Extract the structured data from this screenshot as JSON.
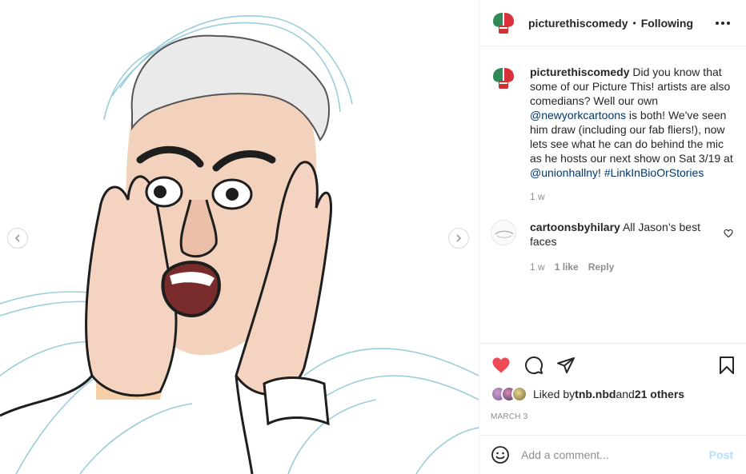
{
  "post": {
    "author": "picturethiscomedy",
    "separator": "•",
    "follow_state": "Following",
    "more_icon": "more-horizontal-icon"
  },
  "caption": {
    "username": "picturethiscomedy",
    "text_1": " Did you know that some of our Picture This! artists are also comedians? Well our own ",
    "mention_1": "@newyorkcartoons",
    "text_2": " is both! We've seen him draw (including our fab fliers!), now lets see what he can do behind the mic as he hosts our next show on Sat 3/19 at ",
    "mention_2": "@unionhallny",
    "text_3": "! ",
    "hashtag": "#LinkInBioOrStories",
    "age": "1 w"
  },
  "comments": [
    {
      "username": "cartoonsbyhilary",
      "text": " All Jason’s best faces",
      "age": "1 w",
      "likes": "1 like",
      "reply": "Reply"
    }
  ],
  "actions": {
    "liked": true,
    "like_color": "#ed4956"
  },
  "likes": {
    "prefix": "Liked by ",
    "user": "tnb.nbd",
    "middle": " and ",
    "others": "21 others"
  },
  "date": "MARCH 3",
  "add_comment": {
    "placeholder": "Add a comment...",
    "post_label": "Post"
  }
}
